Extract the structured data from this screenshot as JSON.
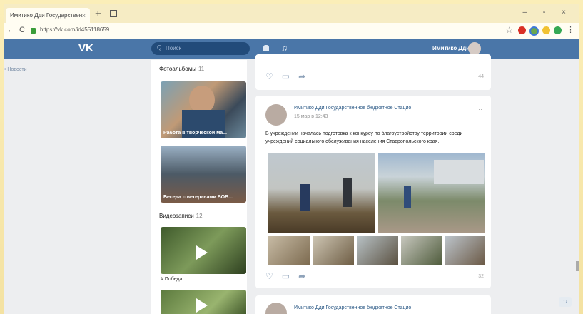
{
  "browser": {
    "tab_title": "Имитико Дди Государственн...",
    "tab_close": "×",
    "new_tab": "+",
    "window_controls": "– ▫ ×",
    "nav_back": "←",
    "nav_reload": "C",
    "url": "https://vk.com/id455118659",
    "bookmark_star": "☆",
    "menu": "⋮"
  },
  "vk": {
    "logo": "VK",
    "search_placeholder": "Поиск",
    "search_icon": "Q",
    "music_icon": "♫",
    "user_name": "Имитико Дди"
  },
  "left_nav": {
    "item": "• Новости"
  },
  "middle": {
    "photos_header": "Фотоальбомы",
    "photos_count": "11",
    "album1_caption": "Работа в творческой ма...",
    "album2_caption": "Беседа с ветеранами ВОВ...",
    "videos_header": "Видеозаписи",
    "videos_count": "12",
    "video1_caption": "# Победа"
  },
  "feed": {
    "top_views": "44",
    "post_author": "Имитико Дди Государственное бюджетное Стацио",
    "post_date": "15 мар в 12:43",
    "post_text": "В учреждении началась подготовка к конкурсу по благоустройству территории среди учреждений социального обслуживания населения Ставропольского края.",
    "post_views": "32",
    "next_author": "Имитико Дди Государственное бюджетное Стацио",
    "scroll_top_label": "↑↓"
  },
  "colors": {
    "vk_blue": "#4a76a8",
    "feed_bg": "#edeef0",
    "link": "#2a5885",
    "frame": "#f7e9b4"
  }
}
